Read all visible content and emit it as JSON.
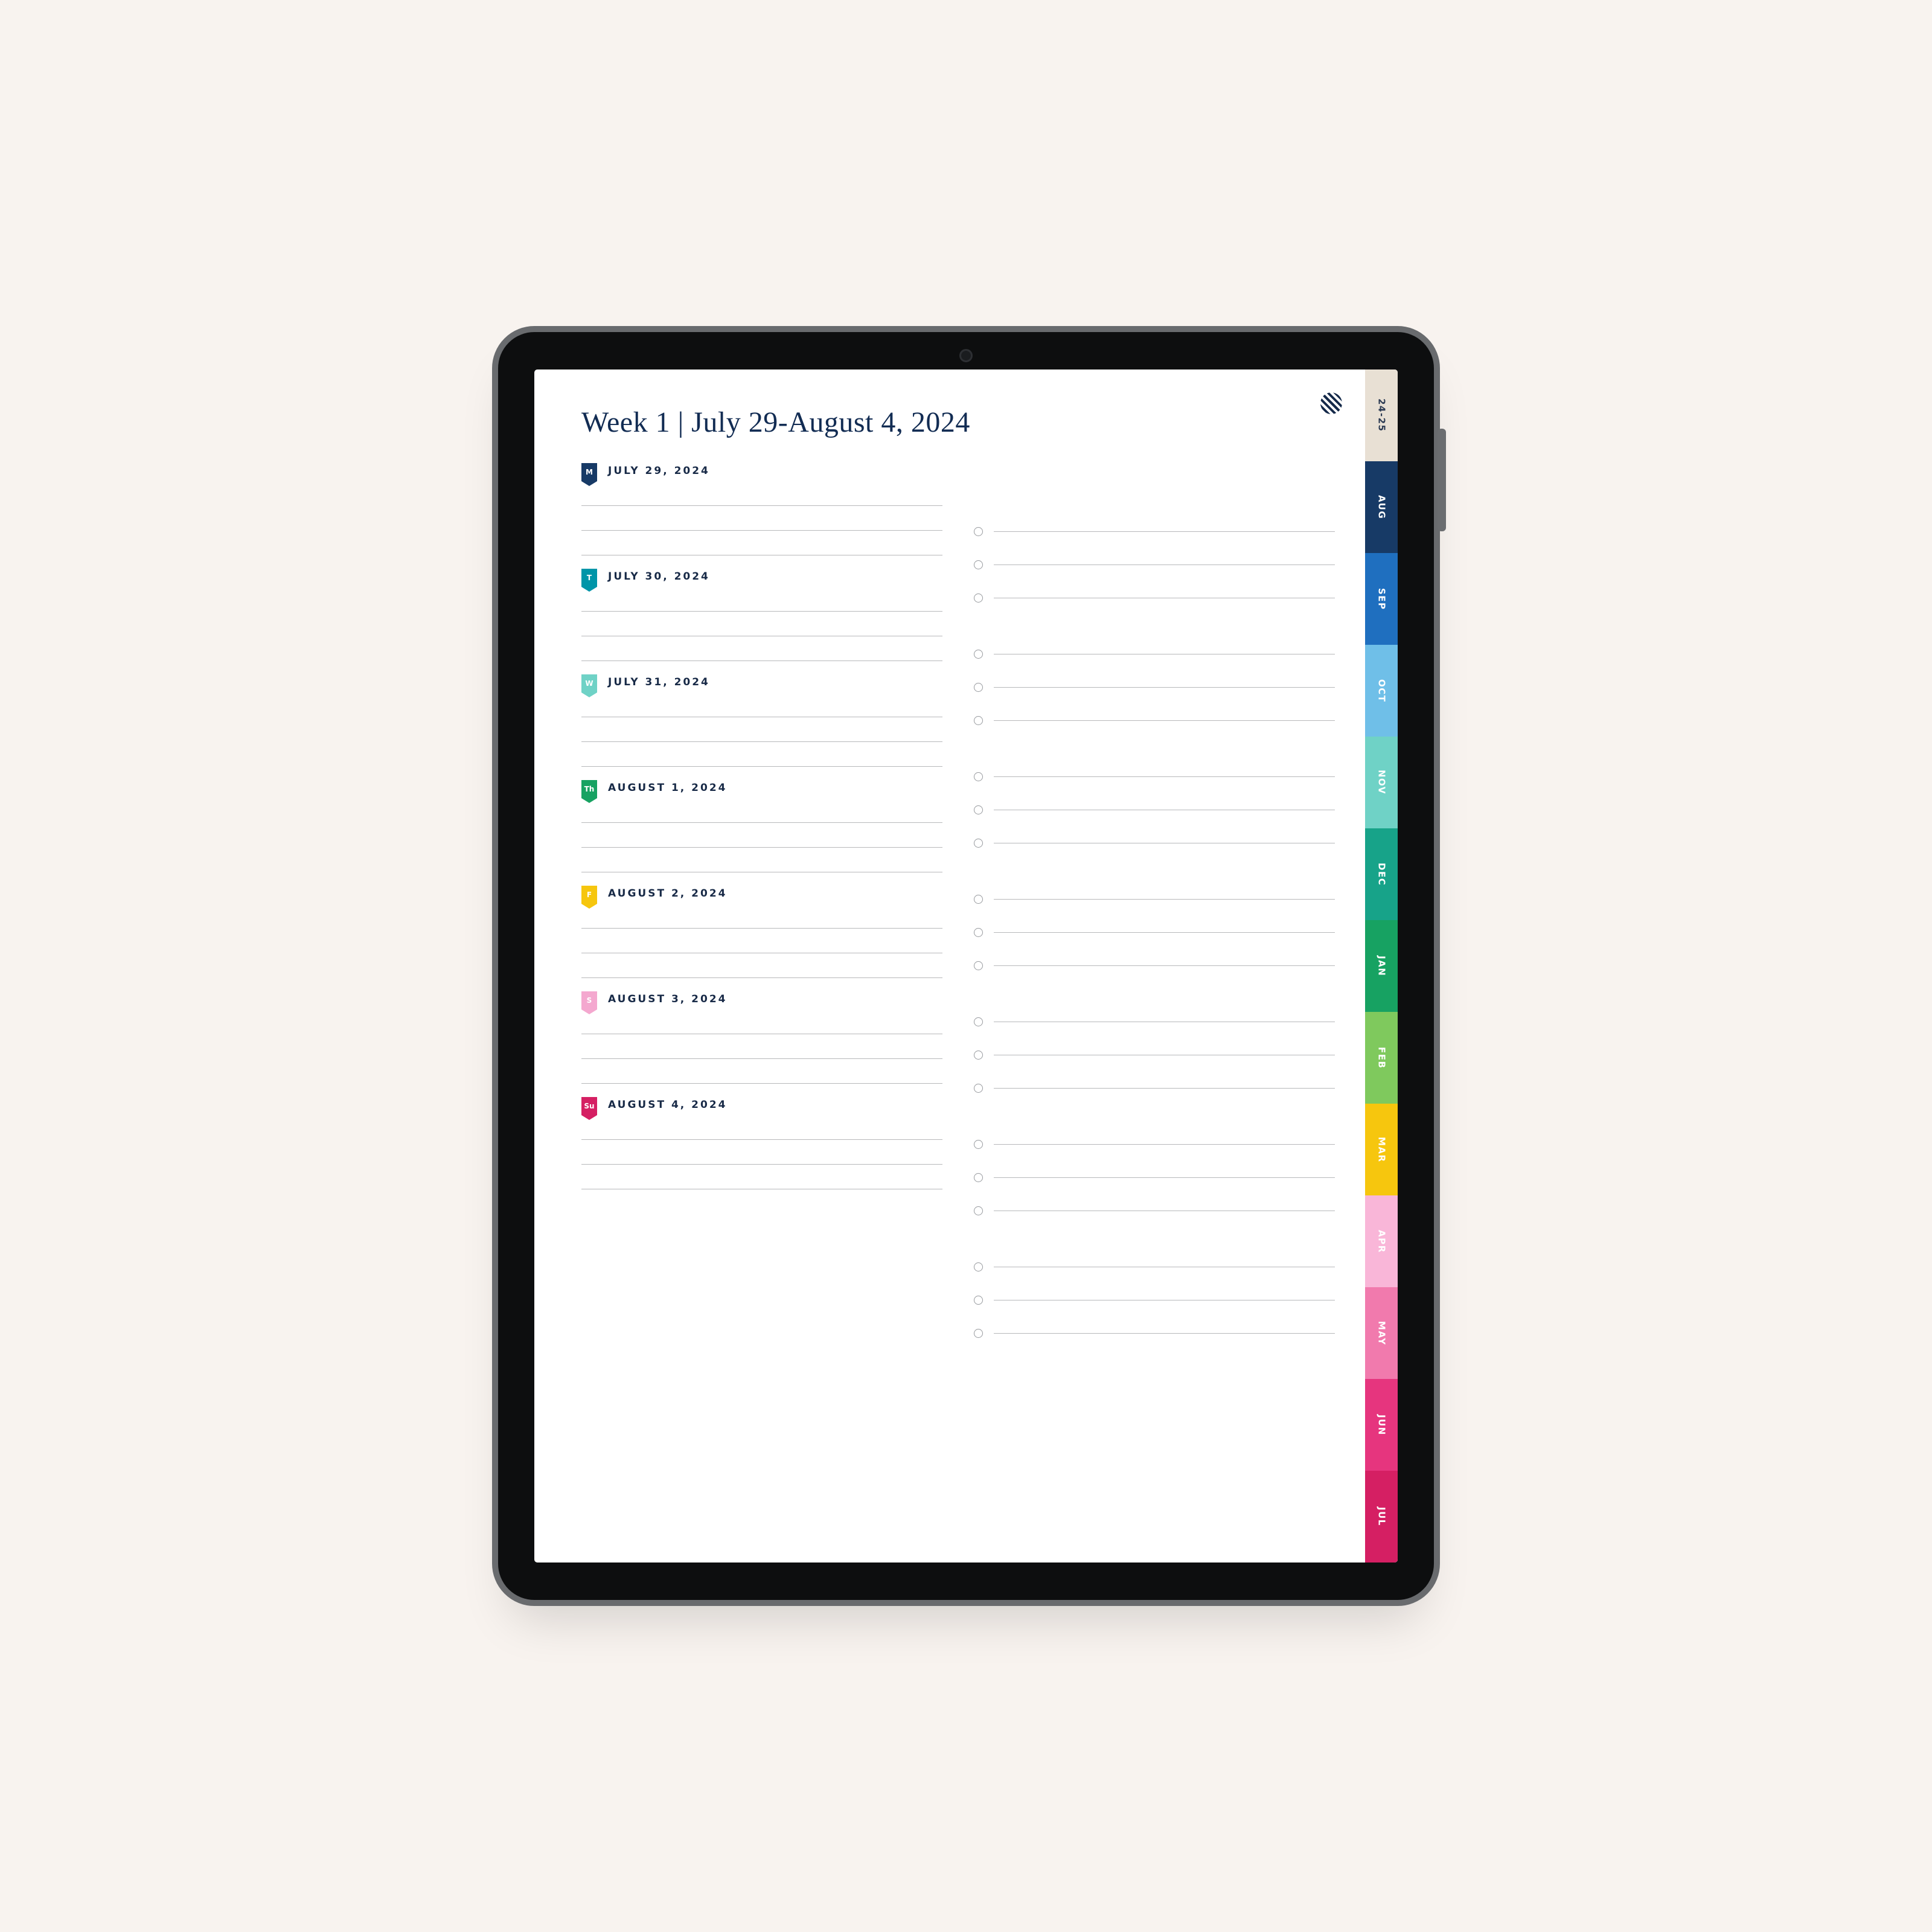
{
  "title": "Week 1  |  July 29-August 4, 2024",
  "days": [
    {
      "abbr": "M",
      "date": "JULY 29, 2024",
      "flag": "navy"
    },
    {
      "abbr": "T",
      "date": "JULY 30, 2024",
      "flag": "teal"
    },
    {
      "abbr": "W",
      "date": "JULY 31, 2024",
      "flag": "mint"
    },
    {
      "abbr": "Th",
      "date": "AUGUST 1, 2024",
      "flag": "green"
    },
    {
      "abbr": "F",
      "date": "AUGUST 2, 2024",
      "flag": "yellow"
    },
    {
      "abbr": "S",
      "date": "AUGUST 3, 2024",
      "flag": "pink"
    },
    {
      "abbr": "Su",
      "date": "AUGUST 4, 2024",
      "flag": "magenta"
    }
  ],
  "left_lines_per_day": 3,
  "right_lines_per_group": 3,
  "tabs": [
    {
      "label": "24-25",
      "bg": "#e8e0d4",
      "fg": "#2b3a52",
      "year": true
    },
    {
      "label": "AUG",
      "bg": "#173a66"
    },
    {
      "label": "SEP",
      "bg": "#1f6fbf"
    },
    {
      "label": "OCT",
      "bg": "#6fbfe8"
    },
    {
      "label": "NOV",
      "bg": "#6fd2c6"
    },
    {
      "label": "DEC",
      "bg": "#17a389"
    },
    {
      "label": "JAN",
      "bg": "#17a262"
    },
    {
      "label": "FEB",
      "bg": "#7fc95d"
    },
    {
      "label": "MAR",
      "bg": "#f6c60e"
    },
    {
      "label": "APR",
      "bg": "#f9b6d8"
    },
    {
      "label": "MAY",
      "bg": "#f17aad"
    },
    {
      "label": "JUN",
      "bg": "#e6357e"
    },
    {
      "label": "JUL",
      "bg": "#d51f63"
    }
  ]
}
